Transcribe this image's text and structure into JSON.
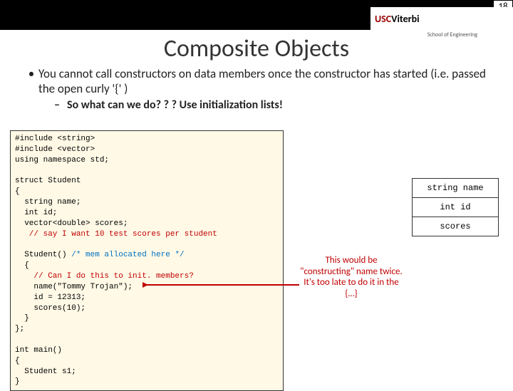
{
  "page_number": "18",
  "logo": {
    "usc": "USC",
    "viterbi": "Viterbi",
    "tagline": "School of Engineering"
  },
  "title": "Composite Objects",
  "bullet_main": "You cannot call constructors on data members once the constructor has started (i.e. passed the open curly '{' )",
  "bullet_sub": "So what can we do? ? ?  Use initialization lists!",
  "code": {
    "l1": "#include <string>",
    "l2": "#include <vector>",
    "l3": "using namespace std;",
    "l4": "",
    "l5": "struct Student",
    "l6": "{",
    "l7": "  string name;",
    "l8": "  int id;",
    "l9": "  vector<double> scores;",
    "c1": "   // say I want 10 test scores per student",
    "l10": "",
    "l11": "  Student() ",
    "c2": "/* mem allocated here */",
    "l12": "  {",
    "c3": "    // Can I do this to init. members?",
    "l13": "    name(\"Tommy Trojan\");",
    "l14": "    id = 12313;",
    "l15": "    scores(10);",
    "l16": "  }",
    "l17": "};",
    "l18": "",
    "l19": "int main()",
    "l20": "{",
    "l21": "  Student s1;",
    "l22": "}"
  },
  "diagram": {
    "r1": "string name",
    "r2": "int id",
    "r3": "scores"
  },
  "annotation": "This would be \"constructing\" name twice. It's too late to do it in the {…}"
}
